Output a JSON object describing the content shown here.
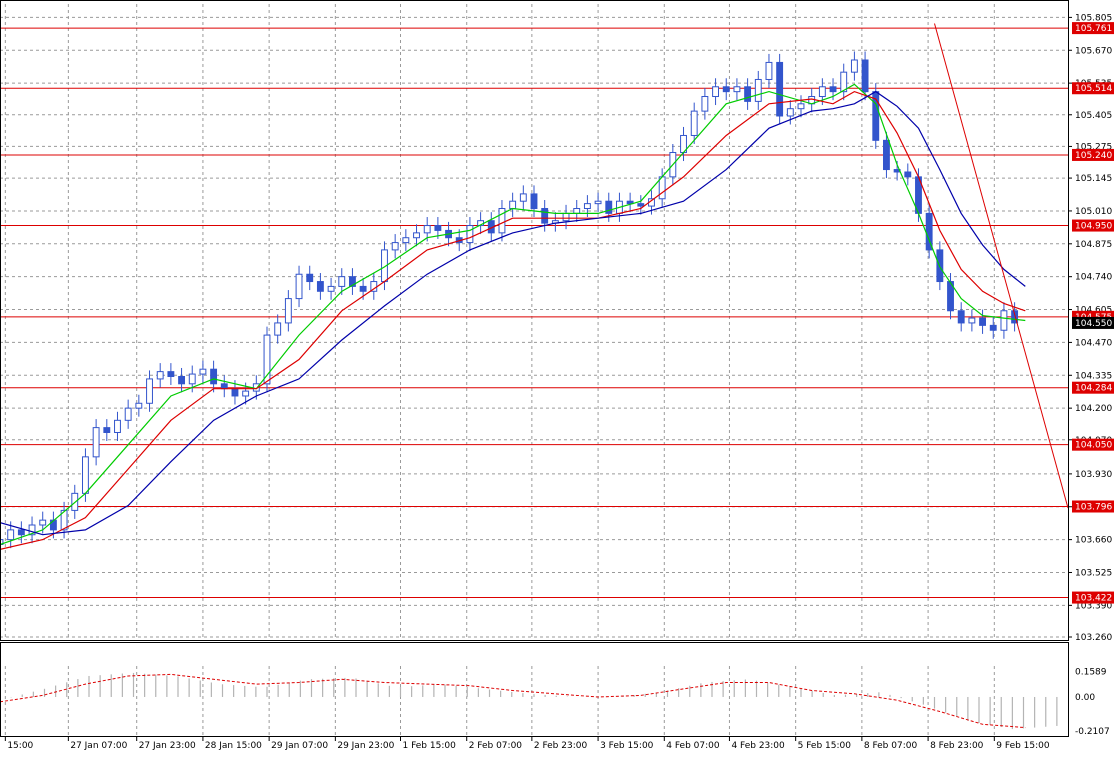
{
  "chart_data": {
    "type": "line",
    "instrument_chart": "candlestick",
    "title": "",
    "colors": {
      "candles": "#3355cc",
      "ma_fast": "#00cc00",
      "ma_mid": "#dd0000",
      "ma_slow": "#0000aa",
      "levels": "#dd0000",
      "trendline": "#dd0000",
      "grid": "#9a9a9a",
      "oscillator_bars": "#b4b4b4",
      "oscillator_signal": "#dd0000"
    },
    "grid": true,
    "ylim": [
      103.26,
      105.86
    ],
    "x_range": [
      0,
      100
    ],
    "price_ticks": [
      "105.805",
      "105.670",
      "105.535",
      "105.405",
      "105.275",
      "105.145",
      "105.010",
      "104.875",
      "104.740",
      "104.605",
      "104.470",
      "104.335",
      "104.200",
      "104.070",
      "103.930",
      "103.795",
      "103.660",
      "103.525",
      "103.390",
      "103.260"
    ],
    "levels": [
      {
        "value": 105.761,
        "label": "105.761"
      },
      {
        "value": 105.514,
        "label": "105.514"
      },
      {
        "value": 105.24,
        "label": "105.240"
      },
      {
        "value": 104.95,
        "label": "104.950"
      },
      {
        "value": 104.575,
        "label": "104.575"
      },
      {
        "value": 104.284,
        "label": "104.284"
      },
      {
        "value": 104.05,
        "label": "104.050"
      },
      {
        "value": 103.796,
        "label": "103.796"
      },
      {
        "value": 103.422,
        "label": "103.422"
      }
    ],
    "current_price": {
      "value": 104.55,
      "label": "104.550"
    },
    "time_labels": [
      {
        "x": 0.5,
        "label": "15:00"
      },
      {
        "x": 6.4,
        "label": "27 Jan 07:00"
      },
      {
        "x": 12.8,
        "label": "27 Jan 23:00"
      },
      {
        "x": 19.0,
        "label": "28 Jan 15:00"
      },
      {
        "x": 25.2,
        "label": "29 Jan 07:00"
      },
      {
        "x": 31.4,
        "label": "29 Jan 23:00"
      },
      {
        "x": 37.5,
        "label": "1 Feb 15:00"
      },
      {
        "x": 43.7,
        "label": "2 Feb 07:00"
      },
      {
        "x": 49.8,
        "label": "2 Feb 23:00"
      },
      {
        "x": 56.0,
        "label": "3 Feb 15:00"
      },
      {
        "x": 62.2,
        "label": "4 Feb 07:00"
      },
      {
        "x": 68.3,
        "label": "4 Feb 23:00"
      },
      {
        "x": 74.5,
        "label": "5 Feb 15:00"
      },
      {
        "x": 80.7,
        "label": "8 Feb 07:00"
      },
      {
        "x": 86.9,
        "label": "8 Feb 23:00"
      },
      {
        "x": 93.1,
        "label": "9 Feb 15:00"
      }
    ],
    "series": [
      {
        "name": "",
        "kind": "close",
        "x": [
          0,
          1,
          2,
          3,
          4,
          5,
          6,
          7,
          8,
          9,
          10,
          11,
          12,
          13,
          14,
          15,
          16,
          17,
          18,
          19,
          20,
          21,
          22,
          23,
          24,
          25,
          26,
          27,
          28,
          29,
          30,
          31,
          32,
          33,
          34,
          35,
          36,
          37,
          38,
          39,
          40,
          41,
          42,
          43,
          44,
          45,
          46,
          47,
          48,
          49,
          50,
          51,
          52,
          53,
          54,
          55,
          56,
          57,
          58,
          59,
          60,
          61,
          62,
          63,
          64,
          65,
          66,
          67,
          68,
          69,
          70,
          71,
          72,
          73,
          74,
          75,
          76,
          77,
          78,
          79,
          80,
          81,
          82,
          83,
          84,
          85,
          86,
          87,
          88,
          89,
          90,
          91,
          92,
          93,
          94,
          95
        ],
        "values": [
          103.66,
          103.7,
          103.68,
          103.72,
          103.74,
          103.7,
          103.78,
          103.85,
          104.0,
          104.12,
          104.1,
          104.15,
          104.2,
          104.22,
          104.32,
          104.35,
          104.33,
          104.3,
          104.34,
          104.36,
          104.3,
          104.28,
          104.25,
          104.27,
          104.3,
          104.5,
          104.55,
          104.65,
          104.75,
          104.72,
          104.68,
          104.7,
          104.74,
          104.7,
          104.68,
          104.72,
          104.85,
          104.88,
          104.9,
          104.92,
          104.95,
          104.93,
          104.9,
          104.88,
          104.95,
          104.97,
          104.92,
          105.02,
          105.05,
          105.08,
          105.02,
          104.96,
          104.97,
          105.0,
          105.02,
          105.04,
          105.05,
          105.0,
          105.05,
          105.04,
          105.03,
          105.06,
          105.15,
          105.25,
          105.32,
          105.42,
          105.48,
          105.52,
          105.5,
          105.52,
          105.46,
          105.55,
          105.62,
          105.4,
          105.43,
          105.45,
          105.48,
          105.52,
          105.5,
          105.58,
          105.63,
          105.5,
          105.3,
          105.18,
          105.17,
          105.15,
          105.0,
          104.85,
          104.72,
          104.6,
          104.55,
          104.57,
          104.54,
          104.52,
          104.6,
          104.55
        ]
      },
      {
        "name": "",
        "kind": "ma_fast",
        "x": [
          0,
          4,
          8,
          12,
          16,
          20,
          24,
          28,
          32,
          36,
          40,
          44,
          48,
          52,
          56,
          60,
          64,
          68,
          72,
          76,
          78,
          80,
          82,
          84,
          86,
          88,
          90,
          92,
          94,
          96
        ],
        "values": [
          103.64,
          103.7,
          103.85,
          104.05,
          104.25,
          104.32,
          104.28,
          104.5,
          104.68,
          104.78,
          104.9,
          104.93,
          105.02,
          105.0,
          105.0,
          105.05,
          105.25,
          105.45,
          105.5,
          105.45,
          105.48,
          105.53,
          105.45,
          105.2,
          105.0,
          104.78,
          104.65,
          104.58,
          104.57,
          104.56
        ]
      },
      {
        "name": "",
        "kind": "ma_mid",
        "x": [
          0,
          4,
          8,
          12,
          16,
          20,
          24,
          28,
          32,
          36,
          40,
          44,
          48,
          52,
          56,
          60,
          64,
          68,
          72,
          76,
          78,
          80,
          82,
          84,
          86,
          88,
          90,
          92,
          94,
          96
        ],
        "values": [
          103.62,
          103.66,
          103.75,
          103.95,
          104.15,
          104.28,
          104.28,
          104.4,
          104.6,
          104.72,
          104.85,
          104.9,
          104.98,
          104.98,
          104.98,
          105.02,
          105.15,
          105.32,
          105.45,
          105.47,
          105.45,
          105.5,
          105.47,
          105.33,
          105.15,
          104.93,
          104.77,
          104.68,
          104.63,
          104.6
        ]
      },
      {
        "name": "",
        "kind": "ma_slow",
        "x": [
          0,
          4,
          8,
          12,
          16,
          20,
          24,
          28,
          32,
          36,
          40,
          44,
          48,
          52,
          56,
          60,
          64,
          68,
          72,
          76,
          78,
          80,
          82,
          84,
          86,
          88,
          90,
          92,
          94,
          96
        ],
        "values": [
          103.73,
          103.68,
          103.7,
          103.8,
          103.98,
          104.15,
          104.25,
          104.32,
          104.48,
          104.62,
          104.75,
          104.85,
          104.92,
          104.96,
          104.98,
          105.0,
          105.05,
          105.18,
          105.35,
          105.42,
          105.43,
          105.45,
          105.5,
          105.44,
          105.35,
          105.18,
          105.0,
          104.87,
          104.77,
          104.7
        ]
      }
    ],
    "trendline": {
      "x": [
        87.5,
        100
      ],
      "values": [
        105.78,
        103.79
      ]
    },
    "oscillator": {
      "ticks": [
        "0.1589",
        "0.00",
        "-0.2107"
      ],
      "ylim": [
        -0.23,
        0.18
      ],
      "x": [
        0,
        4,
        8,
        12,
        16,
        20,
        24,
        28,
        32,
        36,
        40,
        44,
        48,
        52,
        56,
        60,
        64,
        68,
        72,
        76,
        80,
        84,
        88,
        92,
        96
      ],
      "values": [
        -0.02,
        0.05,
        0.13,
        0.15,
        0.13,
        0.08,
        0.06,
        0.11,
        0.12,
        0.06,
        0.08,
        0.05,
        0.02,
        0.0,
        0.0,
        0.03,
        0.09,
        0.11,
        0.06,
        0.01,
        0.03,
        -0.05,
        -0.15,
        -0.2,
        -0.18
      ],
      "signal": [
        -0.03,
        0.01,
        0.08,
        0.13,
        0.14,
        0.11,
        0.08,
        0.09,
        0.11,
        0.09,
        0.08,
        0.07,
        0.04,
        0.02,
        0.0,
        0.01,
        0.05,
        0.09,
        0.09,
        0.04,
        0.02,
        -0.02,
        -0.09,
        -0.17,
        -0.19
      ]
    }
  }
}
